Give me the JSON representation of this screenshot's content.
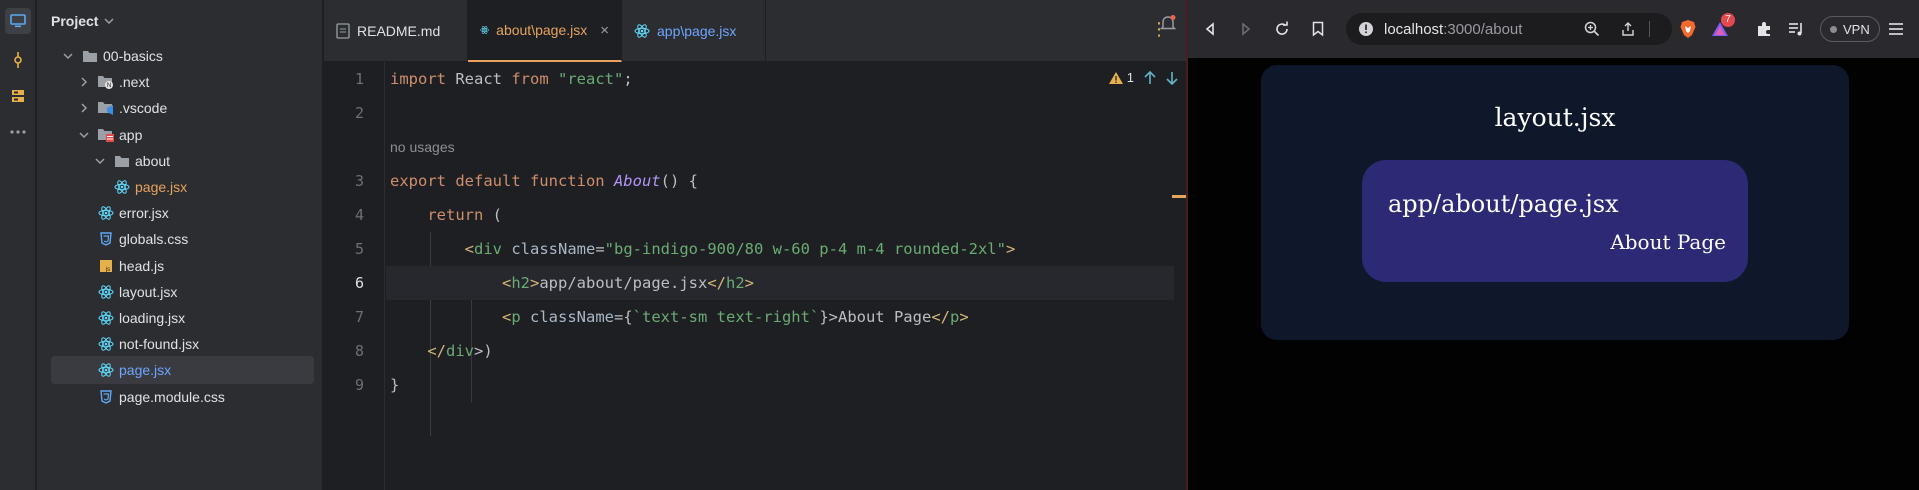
{
  "ide": {
    "project_title": "Project",
    "tree": [
      {
        "label": "00-basics",
        "kind": "folder",
        "level": 0,
        "expanded": true
      },
      {
        "label": ".next",
        "kind": "folder-next",
        "level": 1,
        "expanded": false
      },
      {
        "label": ".vscode",
        "kind": "folder-vscode",
        "level": 1,
        "expanded": false
      },
      {
        "label": "app",
        "kind": "folder-app",
        "level": 1,
        "expanded": true
      },
      {
        "label": "about",
        "kind": "folder",
        "level": 2,
        "expanded": true
      },
      {
        "label": "page.jsx",
        "kind": "react",
        "level": 3,
        "color": "orange"
      },
      {
        "label": "error.jsx",
        "kind": "react",
        "level": 2
      },
      {
        "label": "globals.css",
        "kind": "css",
        "level": 2
      },
      {
        "label": "head.js",
        "kind": "js",
        "level": 2
      },
      {
        "label": "layout.jsx",
        "kind": "react",
        "level": 2
      },
      {
        "label": "loading.jsx",
        "kind": "react",
        "level": 2
      },
      {
        "label": "not-found.jsx",
        "kind": "react",
        "level": 2
      },
      {
        "label": "page.jsx",
        "kind": "react",
        "level": 2,
        "color": "blue",
        "selected": true
      },
      {
        "label": "page.module.css",
        "kind": "css",
        "level": 2
      }
    ],
    "tabs": [
      {
        "label": "README.md"
      },
      {
        "label": "about\\page.jsx",
        "active": true
      },
      {
        "label": "app\\page.jsx"
      }
    ],
    "line_numbers": [
      "1",
      "2",
      "3",
      "4",
      "5",
      "6",
      "7",
      "8",
      "9"
    ],
    "code": {
      "l1_import": "import",
      "l1_react": " React ",
      "l1_from": "from",
      "l1_str": "\"react\"",
      "l1_semi": ";",
      "usages": "no usages",
      "l3_export": "export default function ",
      "l3_fn": "About",
      "l3_rest": "() {",
      "l4_return": "return",
      "l4_rest": " (",
      "l5_open": "<",
      "l5_tag": "div",
      "l5_attr": " className",
      "l5_eq": "=",
      "l5_str": "\"bg-indigo-900/80 w-60 p-4 m-4 rounded-2xl\"",
      "l5_close": ">",
      "l6_a": "<",
      "l6_tag": "h2",
      "l6_b": ">",
      "l6_text": "app/about/page.jsx",
      "l6_c": "</",
      "l6_tag2": "h2",
      "l6_d": ">",
      "l7_a": "<",
      "l7_tag": "p",
      "l7_attr": " className",
      "l7_eq": "={",
      "l7_str": "`text-sm text-right`",
      "l7_b": "}>",
      "l7_text": "About Page",
      "l7_c": "</",
      "l7_tag2": "p",
      "l7_d": ">",
      "l8_a": "</",
      "l8_tag": "div",
      "l8_b": ">)",
      "l9": "}"
    },
    "inspection_count": "1"
  },
  "browser": {
    "url_host": "localhost",
    "url_path": ":3000/about",
    "brave_badge": "7",
    "vpn_label": "VPN",
    "page": {
      "layout_title": "layout.jsx",
      "heading": "app/about/page.jsx",
      "paragraph": "About Page"
    }
  },
  "colors": {
    "accent_orange": "#e8a35c",
    "link_blue": "#6fa5ff",
    "layout_bg": "#0f172a",
    "indigo_box": "#312e81"
  }
}
